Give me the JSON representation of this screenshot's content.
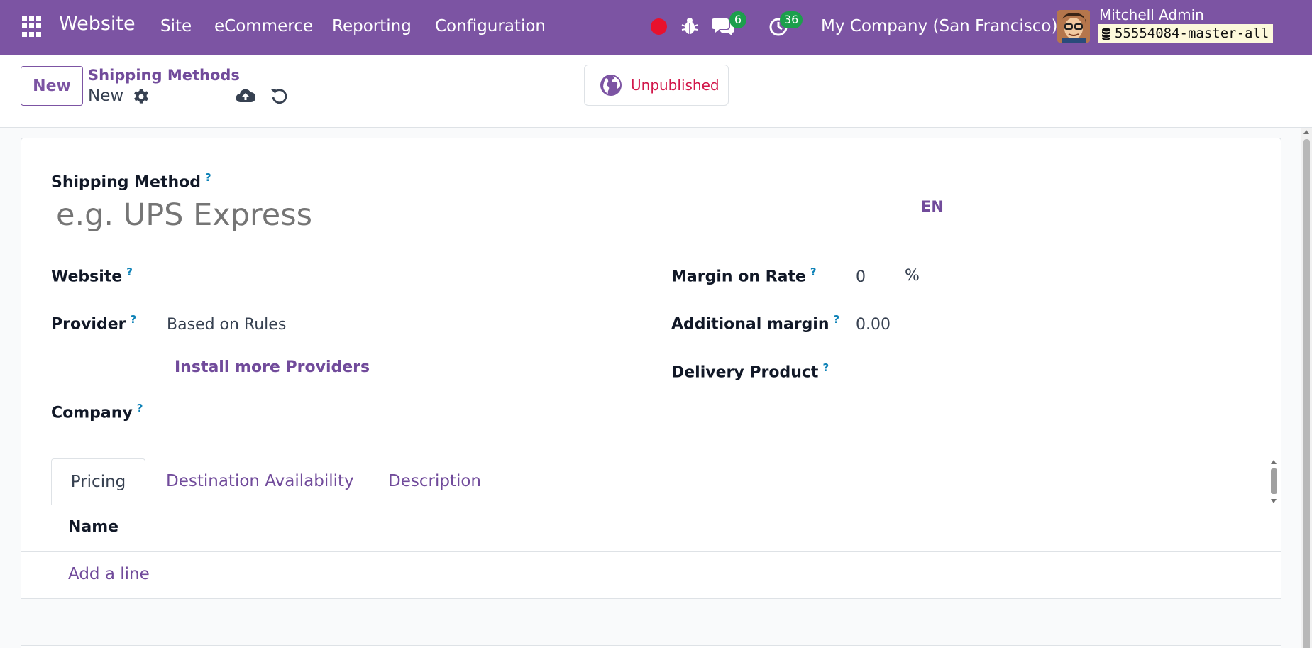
{
  "navbar": {
    "brand": "Website",
    "menu": [
      "Site",
      "eCommerce",
      "Reporting",
      "Configuration"
    ],
    "chat_count": "6",
    "activity_count": "36",
    "company": "My Company (San Francisco)",
    "user_name": "Mitchell Admin",
    "database": "55554084-master-all",
    "accent_color": "#7c54a3"
  },
  "control_panel": {
    "new_label": "New",
    "breadcrumb_parent": "Shipping Methods",
    "breadcrumb_current": "New",
    "publish_status": "Unpublished"
  },
  "form": {
    "shipping_method_label": "Shipping Method",
    "name_placeholder": "e.g. UPS Express",
    "lang": "EN",
    "website_label": "Website",
    "provider_label": "Provider",
    "provider_value": "Based on Rules",
    "install_providers": "Install more Providers",
    "company_label": "Company",
    "margin_rate_label": "Margin on Rate",
    "margin_rate_value": "0",
    "margin_rate_unit": "%",
    "additional_margin_label": "Additional margin",
    "additional_margin_value": "0.00",
    "delivery_product_label": "Delivery Product",
    "help_mark": "?"
  },
  "tabs": [
    "Pricing",
    "Destination Availability",
    "Description"
  ],
  "pricing_table": {
    "columns": [
      "Name"
    ],
    "add_line": "Add a line"
  }
}
